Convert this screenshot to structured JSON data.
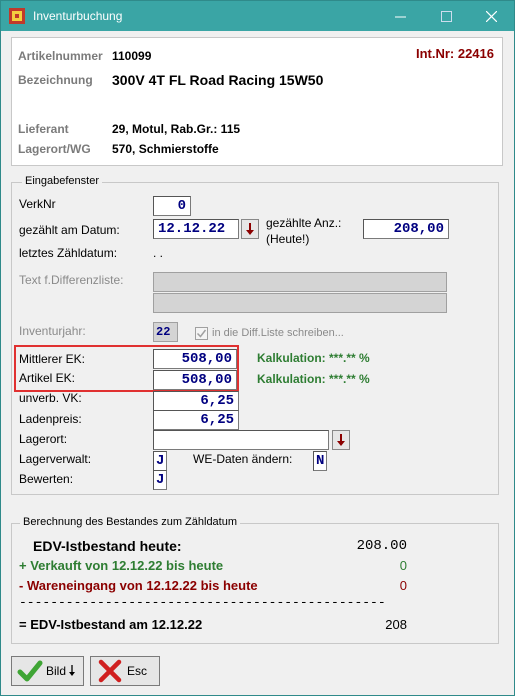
{
  "window": {
    "title": "Inventurbuchung",
    "min_icon": "minimize-icon",
    "max_icon": "maximize-icon",
    "close_icon": "close-icon"
  },
  "info": {
    "artikelnummer_label": "Artikelnummer",
    "artikelnummer": "110099",
    "bezeichnung_label": "Bezeichnung",
    "bezeichnung": "300V 4T FL Road Racing 15W50",
    "lieferant_label": "Lieferant",
    "lieferant": "29, Motul, Rab.Gr.: 115",
    "lagerort_label": "Lagerort/WG",
    "lagerort": "570, Schmierstoffe",
    "intnr": "Int.Nr: 22416"
  },
  "eingabe": {
    "legend": "Eingabefenster",
    "verknr_label": "VerkNr",
    "verknr": "0",
    "datum_label": "gezählt am Datum:",
    "datum": "12.12.22",
    "anz_label_1": "gezählte Anz.:",
    "anz_label_2": "(Heute!)",
    "anz": "208,00",
    "letztes_label": "letztes Zähldatum:",
    "letztes_value": ". .",
    "text_label": "Text f.Differenzliste:",
    "text_1": "",
    "text_2": "",
    "inventurjahr_label": "Inventurjahr:",
    "inventurjahr": "22",
    "diffliste_label": "in die Diff.Liste schreiben...",
    "mittlerer_ek_label": "Mittlerer EK:",
    "mittlerer_ek": "508,00",
    "kalk_1": "Kalkulation: ***.** %",
    "artikel_ek_label": "Artikel EK:",
    "artikel_ek": "508,00",
    "kalk_2": "Kalkulation: ***.** %",
    "unverb_vk_label": "unverb. VK:",
    "unverb_vk": "6,25",
    "ladenpreis_label": "Ladenpreis:",
    "ladenpreis": "6,25",
    "lagerort_label": "Lagerort:",
    "lagerort": "",
    "lagerverwalt_label": "Lagerverwalt:",
    "lagerverwalt": "J",
    "we_label": "WE-Daten ändern:",
    "we": "N",
    "bewerten_label": "Bewerten:",
    "bewerten": "J"
  },
  "berechnung": {
    "legend": "Berechnung des Bestandes zum Zähldatum",
    "edv_label": "EDV-Istbestand heute:",
    "edv_value": "208.00",
    "verkauft_label": "+ Verkauft von 12.12.22 bis heute",
    "verkauft_value": "0",
    "eingang_label": "- Wareneingang von 12.12.22 bis heute",
    "eingang_value": "0",
    "dashes": "-----------------------------------------------",
    "result_label": "= EDV-Istbestand am 12.12.22",
    "result_value": "208"
  },
  "buttons": {
    "bild": "Bild",
    "esc": "Esc"
  },
  "colors": {
    "titlebar": "#3aa5a5",
    "kalkulation": "#2e7d32",
    "intnr": "#8b0000",
    "highlight": "#e03030",
    "field_text": "#000080"
  }
}
